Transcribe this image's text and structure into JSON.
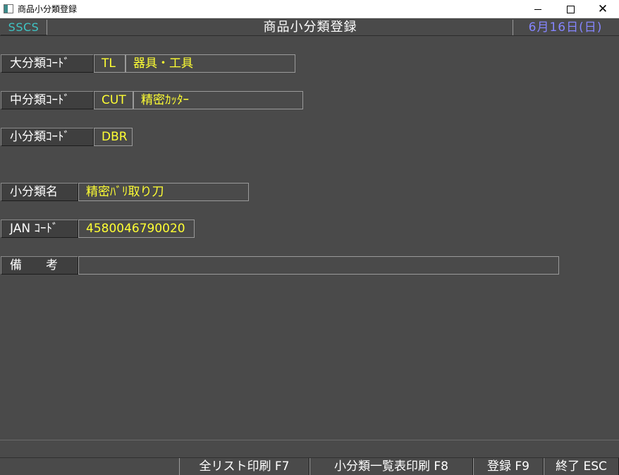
{
  "window": {
    "title": "商品小分類登録",
    "minimize": "—",
    "maximize": "☐",
    "close": "✕"
  },
  "header": {
    "system": "SSCS",
    "title": "商品小分類登録",
    "date": "6月16日(日)"
  },
  "fields": {
    "large_code": {
      "label": "大分類ｺｰﾄﾞ",
      "code": "TL",
      "name": "器具・工具"
    },
    "mid_code": {
      "label": "中分類ｺｰﾄﾞ",
      "code": "CUT",
      "name": "精密ｶｯﾀｰ"
    },
    "small_code": {
      "label": "小分類ｺｰﾄﾞ",
      "code": "DBR"
    },
    "small_name": {
      "label": "小分類名",
      "value": "精密ﾊﾞﾘ取り刀"
    },
    "jan_code": {
      "label": "JAN ｺｰﾄﾞ",
      "value": "4580046790020"
    },
    "remarks": {
      "label": "備　　考",
      "value": ""
    }
  },
  "function_keys": {
    "all_list_print": "全リスト印刷 F7",
    "list_print": "小分類一覧表印刷 F8",
    "register": "登録 F9",
    "exit": "終了 ESC"
  },
  "colors": {
    "background": "#4a4a4a",
    "value_text": "#ffff33",
    "system_code": "#3fc4c4",
    "date": "#8585ff"
  }
}
